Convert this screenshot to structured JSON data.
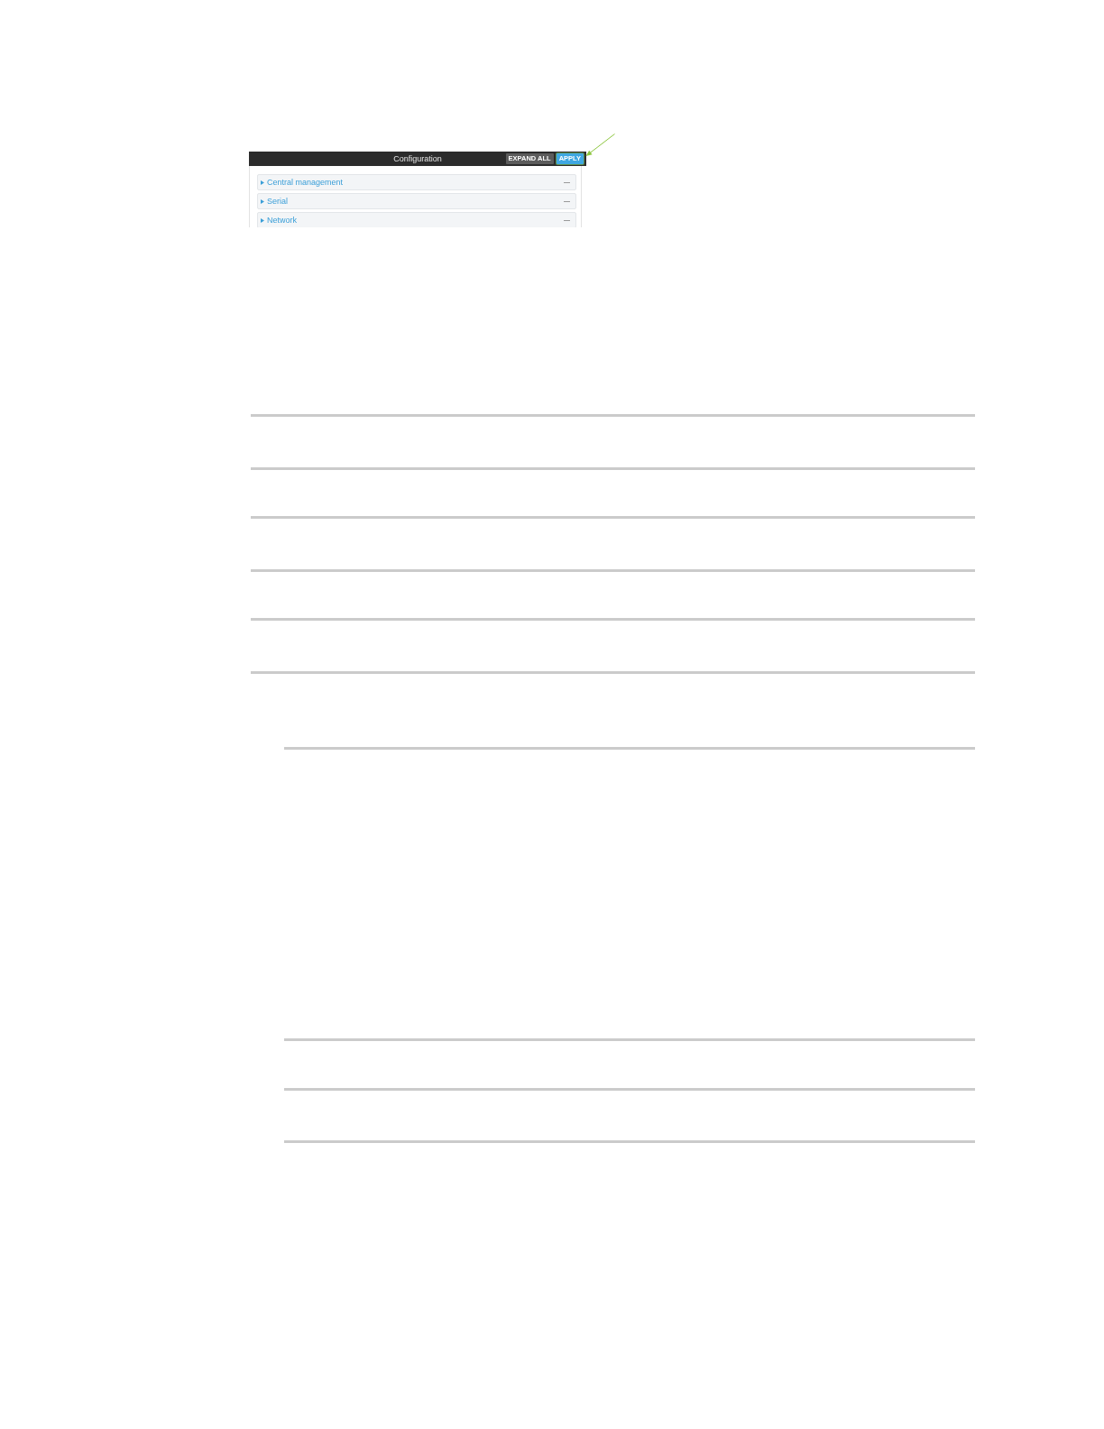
{
  "screenshot": {
    "title": "Configuration",
    "buttons": [
      {
        "label": "EXPAND ALL",
        "kind": "secondary",
        "callout": false
      },
      {
        "label": "APPLY",
        "kind": "primary",
        "callout": true
      }
    ],
    "sections": [
      {
        "label": "Central management",
        "expanded": false
      },
      {
        "label": "Serial",
        "expanded": false
      },
      {
        "label": "Network",
        "expanded": false
      }
    ]
  }
}
